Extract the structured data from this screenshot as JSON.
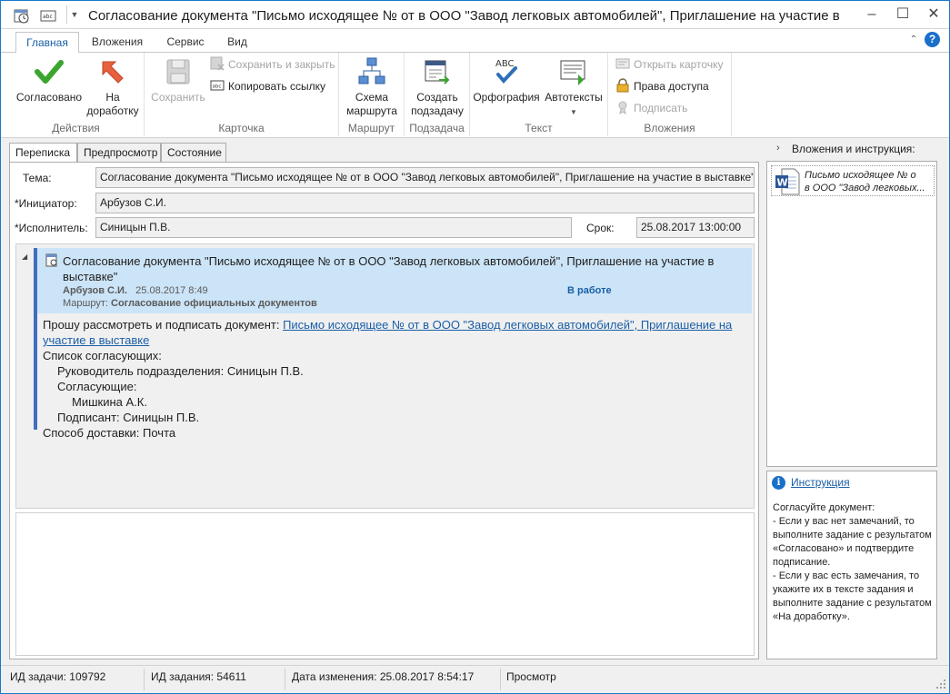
{
  "window": {
    "title": "Согласование документа \"Письмо исходящее №  от  в ООО \"Завод легковых автомобилей\",  Приглашение на участие в выставке\""
  },
  "ribbon": {
    "tabs": [
      {
        "label": "Главная",
        "active": true
      },
      {
        "label": "Вложения",
        "active": false
      },
      {
        "label": "Сервис",
        "active": false
      },
      {
        "label": "Вид",
        "active": false
      }
    ],
    "groups": {
      "actions": {
        "label": "Действия",
        "approve": "Согласовано",
        "rework_line1": "На",
        "rework_line2": "доработку"
      },
      "card": {
        "label": "Карточка",
        "save": "Сохранить",
        "save_close": "Сохранить и закрыть",
        "copy_link": "Копировать ссылку"
      },
      "route": {
        "label": "Маршрут",
        "scheme_line1": "Схема",
        "scheme_line2": "маршрута"
      },
      "subtask": {
        "label": "Подзадача",
        "create_line1": "Создать",
        "create_line2": "подзадачу"
      },
      "text": {
        "label": "Текст",
        "spelling": "Орфография",
        "autotext": "Автотексты"
      },
      "attachments": {
        "label": "Вложения",
        "open_card": "Открыть карточку",
        "access_rights": "Права доступа",
        "sign": "Подписать"
      }
    }
  },
  "content_tabs": [
    {
      "label": "Переписка",
      "active": true
    },
    {
      "label": "Предпросмотр",
      "active": false
    },
    {
      "label": "Состояние",
      "active": false
    }
  ],
  "form": {
    "subject_label": "Тема:",
    "subject_value": "Согласование документа \"Письмо исходящее №  от  в ООО \"Завод легковых автомобилей\",  Приглашение на участие в выставке\"",
    "initiator_label": "*Инициатор:",
    "initiator_value": "Арбузов С.И.",
    "executor_label": "*Исполнитель:",
    "executor_value": "Синицын П.В.",
    "deadline_label": "Срок:",
    "deadline_value": "25.08.2017 13:00:00"
  },
  "message": {
    "title": "Согласование документа \"Письмо исходящее № от в ООО \"Завод легковых автомобилей\", Приглашение на участие в выставке\"",
    "author": "Арбузов С.И.",
    "date": "25.08.2017 8:49",
    "status": "В работе",
    "route_label": "Маршрут:",
    "route_value": "Согласование официальных документов",
    "body_intro": "Прошу рассмотреть и подписать документ: ",
    "body_link_line1": "Письмо исходящее №  от  в ООО \"Завод легковых автомобилей\",  Приглашение на",
    "body_link_line2": "участие в выставке",
    "approvers_title": "Список согласующих:",
    "head_line": "Руководитель подразделения: Синицын П.В.",
    "approvers_label": "Согласующие:",
    "approver_name": "Мишкина А.К.",
    "signer_line": "Подписант: Синицын П.В.",
    "delivery_line": "Способ доставки: Почта"
  },
  "right_panel": {
    "header": "Вложения и инструкция:",
    "attachment_line1": "Письмо исходящее №  о",
    "attachment_line2": "в ООО \"Завод легковых...",
    "instruction_title": "Инструкция",
    "instruction_text": "Согласуйте документ:\n- Если у вас нет замечаний, то выполните задание с результатом «Согласовано» и подтвердите подписание.\n- Если у вас есть замечания, то укажите их в тексте задания и выполните задание с результатом «На доработку»."
  },
  "statusbar": {
    "task_id": "ИД задачи: 109792",
    "assignment_id": "ИД задания: 54611",
    "modified": "Дата изменения: 25.08.2017 8:54:17",
    "mode": "Просмотр"
  },
  "colors": {
    "accent": "#1a5ea8",
    "header_bg": "#cce4f7",
    "approve_green": "#3aa52f",
    "rework_orange": "#e8603c"
  }
}
